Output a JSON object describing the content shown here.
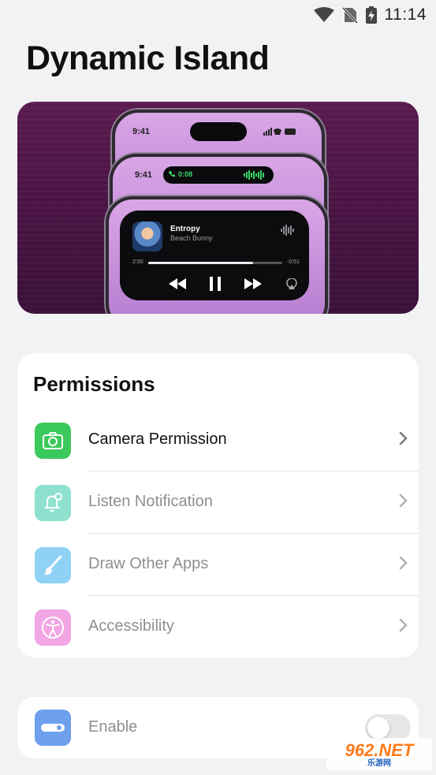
{
  "status": {
    "time": "11:14",
    "icons": [
      "wifi-icon",
      "no-sim-icon",
      "battery-charging-icon"
    ]
  },
  "page": {
    "title": "Dynamic Island"
  },
  "hero": {
    "phones": [
      {
        "time": "9:41"
      },
      {
        "time": "9:41",
        "call_time": "0:08"
      },
      {
        "track_title": "Entropy",
        "track_artist": "Beach Bunny",
        "elapsed": "2:50",
        "remaining": "-0:51",
        "progress": 0.78
      }
    ]
  },
  "permissions": {
    "title": "Permissions",
    "items": [
      {
        "label": "Camera Permission",
        "icon": "camera-icon",
        "color": "#3cc95b",
        "text_color": "#111111"
      },
      {
        "label": "Listen Notification",
        "icon": "bell-icon",
        "color": "#8ee0cf",
        "text_color": "#8e8e93"
      },
      {
        "label": "Draw Other Apps",
        "icon": "brush-icon",
        "color": "#8fd2f5",
        "text_color": "#8e8e93"
      },
      {
        "label": "Accessibility",
        "icon": "accessibility-icon",
        "color": "#f2a6e4",
        "text_color": "#8e8e93"
      }
    ]
  },
  "enable": {
    "label": "Enable",
    "icon": "toggle-pill-icon",
    "color": "#6fa0ee",
    "on": false
  },
  "watermark": {
    "top": "962.NET",
    "bottom": "乐游网"
  }
}
